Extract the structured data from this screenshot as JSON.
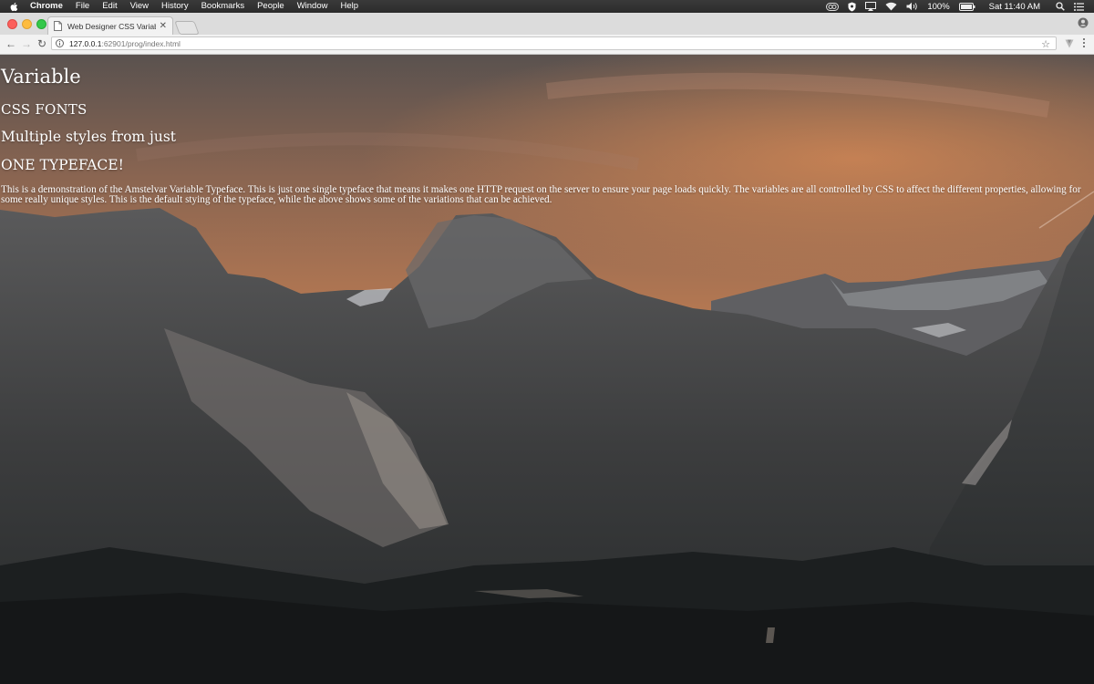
{
  "menubar": {
    "app": "Chrome",
    "items": [
      "File",
      "Edit",
      "View",
      "History",
      "Bookmarks",
      "People",
      "Window",
      "Help"
    ],
    "battery": "100%",
    "clock": "Sat 11:40 AM"
  },
  "browser": {
    "tab_title": "Web Designer CSS Variable Fo",
    "url_host": "127.0.0.1",
    "url_path": ":62901/prog/index.html"
  },
  "page": {
    "heading1": "Variable",
    "heading2": "CSS FONTS",
    "heading3": "Multiple styles from just",
    "heading4": "ONE TYPEFACE!",
    "paragraph": "This is a demonstration of the Amstelvar Variable Typeface. This is just one single typeface that means it makes one HTTP request on the server to ensure your page loads quickly. The variables are all controlled by CSS to affect the different properties, allowing for some really unique styles. This is the default stying of the typeface, while the above shows some of the variations that can be achieved."
  },
  "colors": {
    "sky_top": "#5f5550",
    "sky_glow": "#b7764f",
    "mountain": "#3a3a3b",
    "forest": "#1c1f1f"
  }
}
